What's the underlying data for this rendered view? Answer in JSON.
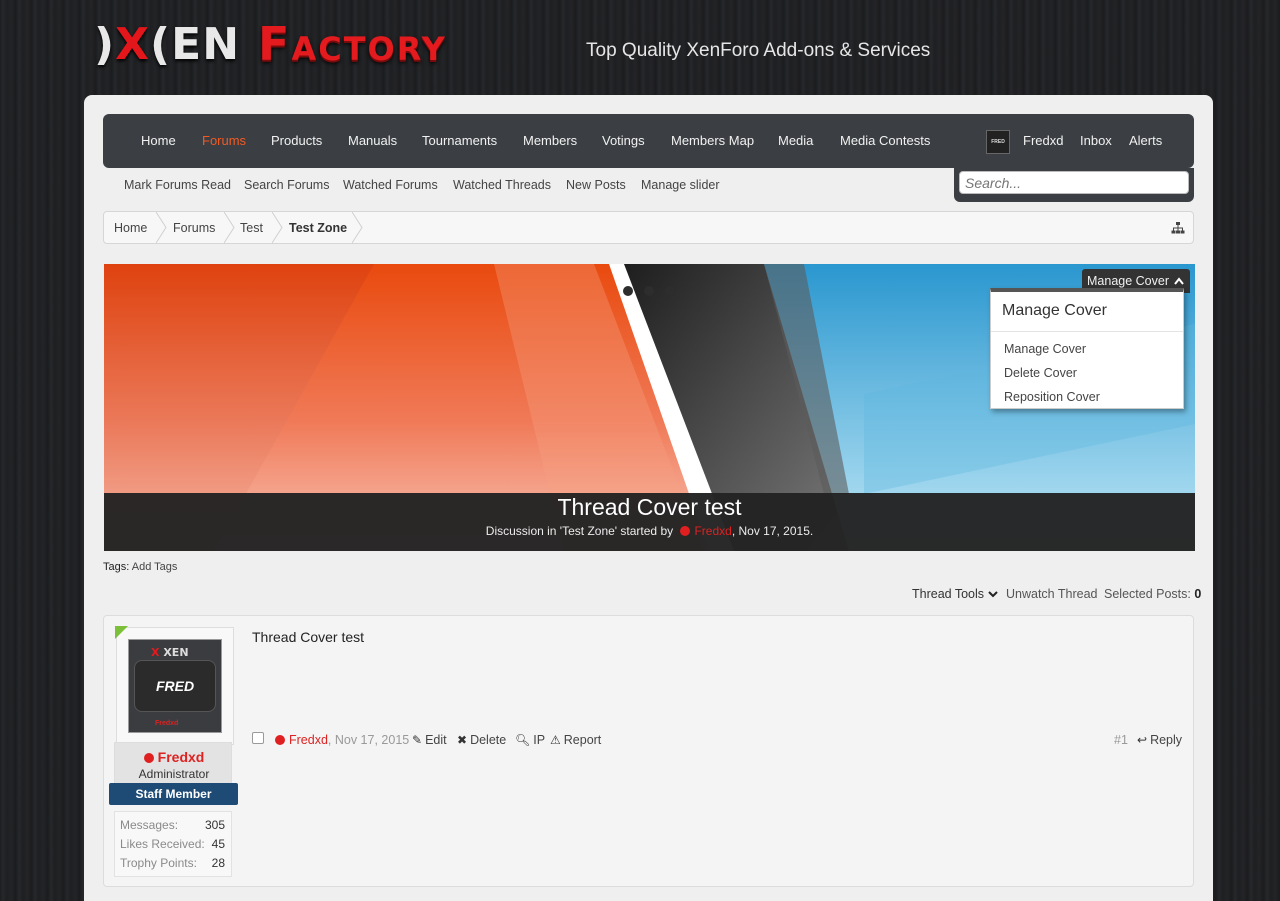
{
  "header": {
    "logo_text": "XenFactory",
    "tagline": "Top Quality XenForo Add-ons & Services"
  },
  "nav": {
    "items": [
      {
        "label": "Home"
      },
      {
        "label": "Forums"
      },
      {
        "label": "Products"
      },
      {
        "label": "Manuals"
      },
      {
        "label": "Tournaments"
      },
      {
        "label": "Members"
      },
      {
        "label": "Votings"
      },
      {
        "label": "Members Map"
      },
      {
        "label": "Media"
      },
      {
        "label": "Media Contests"
      }
    ],
    "active": "Forums",
    "user": {
      "name": "Fredxd",
      "avatar_text": "FRED"
    },
    "inbox": "Inbox",
    "alerts": "Alerts"
  },
  "subnav": {
    "items": [
      {
        "label": "Mark Forums Read"
      },
      {
        "label": "Search Forums"
      },
      {
        "label": "Watched Forums"
      },
      {
        "label": "Watched Threads"
      },
      {
        "label": "New Posts"
      },
      {
        "label": "Manage slider"
      }
    ]
  },
  "search": {
    "placeholder": "Search..."
  },
  "breadcrumb": {
    "items": [
      {
        "label": "Home"
      },
      {
        "label": "Forums"
      },
      {
        "label": "Test"
      },
      {
        "label": "Test Zone"
      }
    ]
  },
  "cover": {
    "title": "Thread Cover test",
    "meta_prefix": "Discussion in 'Test Zone' started by",
    "author": "Fredxd",
    "date": ", Nov 17, 2015.",
    "manage_button": "Manage Cover",
    "menu": {
      "heading": "Manage Cover",
      "items": [
        {
          "label": "Manage Cover"
        },
        {
          "label": "Delete Cover"
        },
        {
          "label": "Reposition Cover"
        }
      ]
    }
  },
  "tags": {
    "label": "Tags:",
    "add": "Add Tags"
  },
  "thread_tools": {
    "tools": "Thread Tools",
    "unwatch": "Unwatch Thread",
    "selected_label": "Selected Posts:",
    "selected_count": "0"
  },
  "post": {
    "message": "Thread Cover test",
    "author": "Fredxd",
    "title": "Administrator",
    "banner": "Staff Member",
    "avatar_brand": "XEN",
    "avatar_name": "FRED",
    "avatar_footer": "Fredxd",
    "stats": [
      {
        "label": "Messages:",
        "value": "305"
      },
      {
        "label": "Likes Received:",
        "value": "45"
      },
      {
        "label": "Trophy Points:",
        "value": "28"
      }
    ],
    "date": "Nov 17, 2015",
    "edit": "Edit",
    "delete": "Delete",
    "ip": "IP",
    "report": "Report",
    "number": "#1",
    "reply": "Reply"
  },
  "colors": {
    "accent": "#f15a24",
    "brand_red": "#e31b1f",
    "username_red": "#dd2222",
    "nav_bg": "#3b3f43",
    "staff_banner": "#1d4b75"
  }
}
